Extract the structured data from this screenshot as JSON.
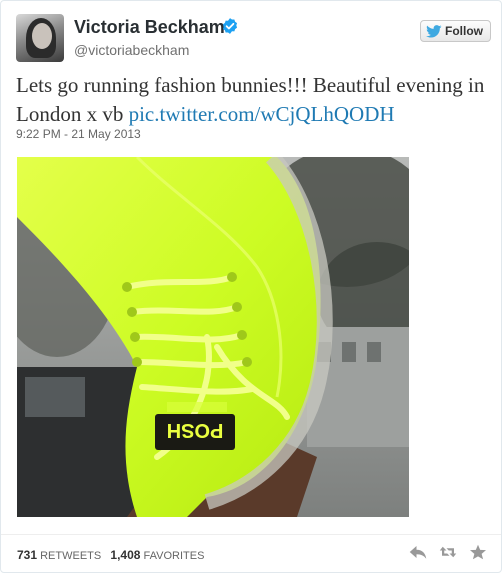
{
  "header": {
    "display_name": "Victoria Beckham",
    "username": "@victoriabeckham",
    "follow_label": "Follow"
  },
  "tweet": {
    "text": "Lets go running fashion bunnies!!! Beautiful evening in London x vb ",
    "link": "pic.twitter.com/wCjQLhQODH",
    "timestamp": "9:22 PM - 21 May 2013"
  },
  "photo": {
    "tongue_label": "POSH"
  },
  "stats": {
    "retweets_count": "731",
    "retweets_label": "RETWEETS",
    "favorites_count": "1,408",
    "favorites_label": "FAVORITES"
  },
  "actions": {
    "icons": [
      "reply-icon",
      "retweet-icon",
      "favorite-icon"
    ]
  },
  "colors": {
    "link": "#1f7ab3",
    "verified": "#1da1f2",
    "twitter_bird": "#3fa9e1",
    "shoe": "#d4ff2a"
  }
}
